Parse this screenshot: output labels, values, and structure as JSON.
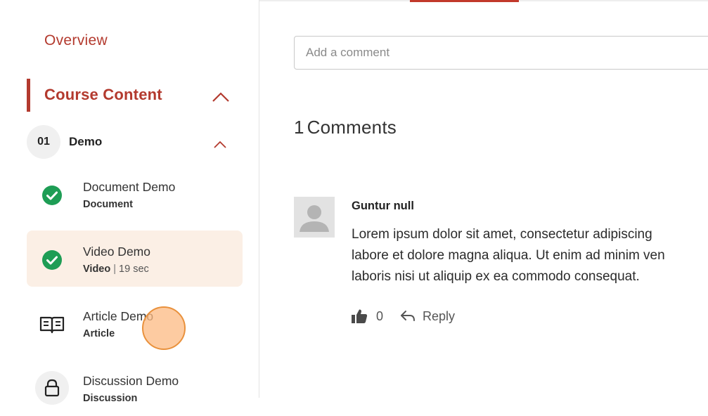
{
  "sidebar": {
    "overview_label": "Overview",
    "course_content_label": "Course Content",
    "module": {
      "number": "01",
      "title": "Demo"
    },
    "lessons": [
      {
        "title": "Document Demo",
        "type": "Document",
        "duration": "",
        "status": "completed",
        "icon": "check-circle-icon"
      },
      {
        "title": "Video Demo",
        "type": "Video",
        "separator": "|",
        "duration": "19 sec",
        "status": "completed",
        "icon": "check-circle-icon",
        "active": true
      },
      {
        "title": "Article Demo",
        "type": "Article",
        "duration": "",
        "status": "not-started",
        "icon": "open-book-icon"
      },
      {
        "title": "Discussion Demo",
        "type": "Discussion",
        "duration": "",
        "status": "locked",
        "icon": "lock-icon"
      }
    ]
  },
  "comments": {
    "input_placeholder": "Add a comment",
    "count": "1",
    "count_label": "Comments",
    "items": [
      {
        "author": "Guntur null",
        "lines": [
          "Lorem ipsum dolor sit amet, consectetur adipiscing",
          "labore et dolore magna aliqua. Ut enim ad minim ven",
          "laboris nisi ut aliquip ex ea commodo consequat."
        ],
        "likes": "0",
        "reply_label": "Reply"
      }
    ]
  },
  "colors": {
    "accent": "#b33a2e",
    "tab_accent": "#c2392b",
    "success": "#1e9d55",
    "active_lesson_bg": "#fbefe5"
  }
}
